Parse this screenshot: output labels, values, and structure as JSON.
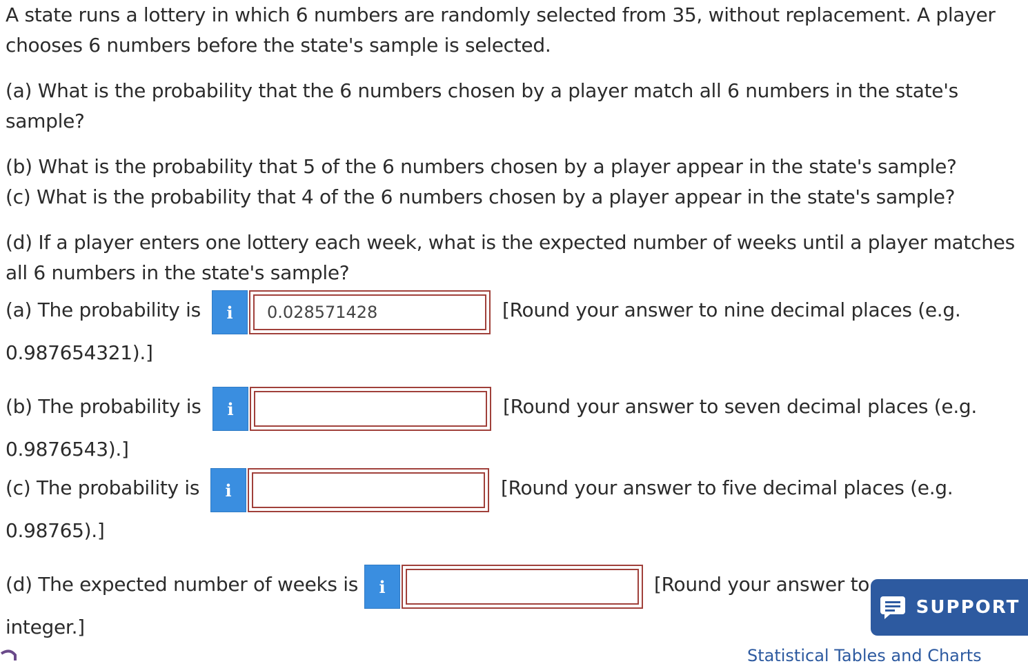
{
  "problem": {
    "intro": "A state runs a lottery in which 6 numbers are randomly selected from 35, without replacement. A player chooses 6 numbers before the state's sample is selected.",
    "q_a": "(a) What is the probability that the 6 numbers chosen by a player match all 6 numbers in the state's sample?",
    "q_b": "(b) What is the probability that 5 of the 6 numbers chosen by a player appear in the state's sample?",
    "q_c": "(c) What is the probability that 4 of the 6 numbers chosen by a player appear in the state's sample?",
    "q_d": "(d) If a player enters one lottery each week, what is the expected number of weeks until a player matches all 6 numbers in the state's sample?"
  },
  "answers": {
    "a": {
      "label": "(a) The probability is",
      "value": "0.028571428",
      "hint": "[Round your answer to nine decimal places (e.g.",
      "hint_tail": "0.987654321).]"
    },
    "b": {
      "label": "(b) The probability is",
      "value": "",
      "hint": "[Round your answer to seven decimal places (e.g.",
      "hint_tail": "0.9876543).]"
    },
    "c": {
      "label": "(c) The probability is",
      "value": "",
      "hint": "[Round your answer to five decimal places (e.g.",
      "hint_tail": "0.98765).]"
    },
    "d": {
      "label": "(d) The expected number of weeks is",
      "value": "",
      "hint": "[Round your answer to",
      "hint_tail": "integer.]"
    }
  },
  "info_icon_glyph": "i",
  "icons": {
    "info": "info-icon",
    "support": "chat-message-icon"
  },
  "support": {
    "label": "SUPPORT"
  },
  "footer": {
    "stat_link": "Statistical Tables and Charts"
  },
  "colors": {
    "accent": "#3a8ee0",
    "border_error": "#a0403a",
    "support_bg": "#2d5aa0"
  }
}
